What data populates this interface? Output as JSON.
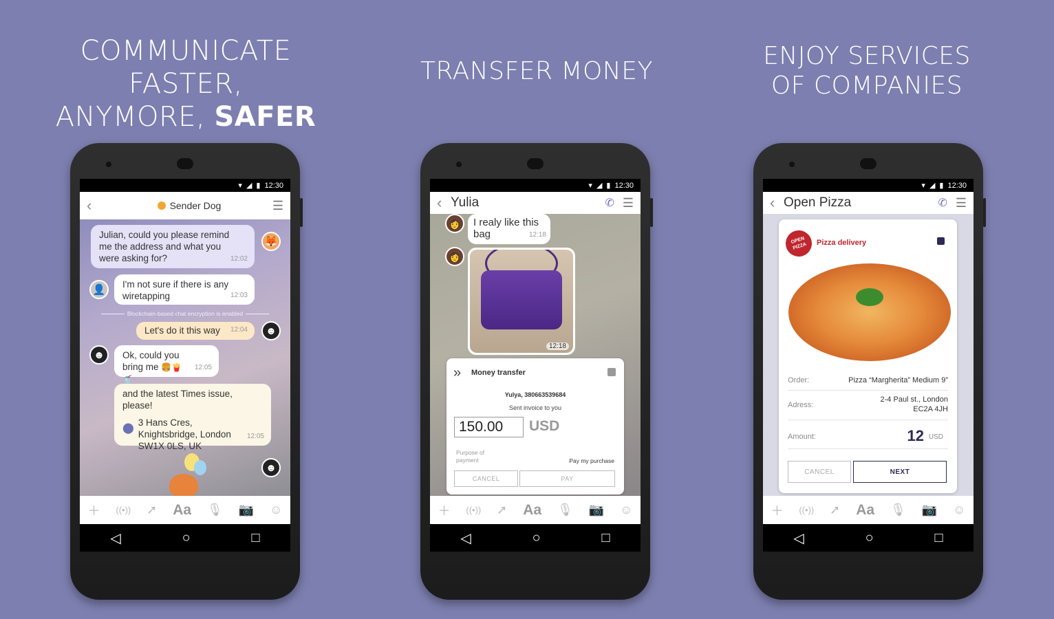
{
  "headlines": {
    "left_line1": "COMMUNICATE FASTER,",
    "left_line2_pre": "ANYMORE, ",
    "left_line2_bold": "SAFER",
    "middle": "TRANSFER MONEY",
    "right_line1": "ENJOY SERVICES",
    "right_line2": "OF COMPANIES"
  },
  "status": {
    "time": "12:30"
  },
  "phone1": {
    "title": "Sender Dog",
    "messages": [
      {
        "text": "Julian, could you please remind me the address and what you were asking for?",
        "time": "12:02"
      },
      {
        "text": "I'm not sure if there is any wiretapping",
        "time": "12:03"
      },
      {
        "text": "Let's do it this way",
        "time": "12:04"
      },
      {
        "text": "Ok, could you bring me",
        "emoji": "🍔🍟🥤",
        "time": "12:05"
      },
      {
        "text": "and the latest Times issue, please!",
        "address": "3 Hans Cres, Knightsbridge, London SW1X 0LS, UK",
        "time": "12:05"
      }
    ],
    "divider": "Blockchain-based chat encryption is enabled"
  },
  "phone2": {
    "title": "Yulia",
    "msg1": {
      "text": "I realy like this bag",
      "time": "12:18"
    },
    "photo_time": "12:18",
    "transfer": {
      "title": "Money transfer",
      "recipient": "Yulya, 380663539684",
      "subtitle": "Sent invoice to you",
      "amount": "150.00",
      "currency": "USD",
      "purpose_label": "Purpose of payment",
      "purpose_value": "Pay my purchase",
      "cancel": "CANCEL",
      "pay": "PAY"
    }
  },
  "phone3": {
    "title": "Open Pizza",
    "logo_text": "OPEN PIZZA",
    "service": "Pizza delivery",
    "order_label": "Order:",
    "order_value": "Pizza “Margherita” Medium 9”",
    "address_label": "Adress:",
    "address_line1": "2-4 Paul st., London",
    "address_line2": "EC2A 4JH",
    "amount_label": "Amount:",
    "amount_value": "12",
    "amount_currency": "USD",
    "cancel": "CANCEL",
    "next": "NEXT"
  },
  "toolbar": {
    "aa": "Aa"
  },
  "colors": {
    "background": "#7d7fb0",
    "accent": "#6b71b5",
    "pizza_red": "#c0262d"
  }
}
